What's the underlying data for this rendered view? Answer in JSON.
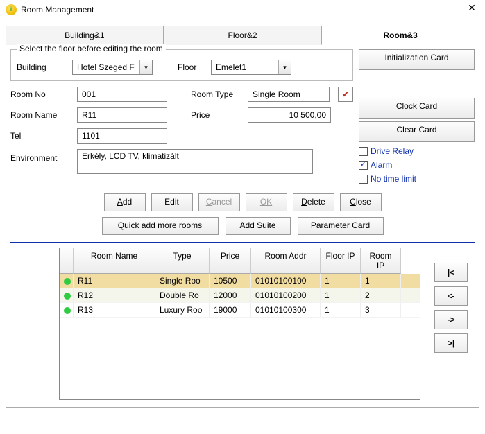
{
  "window": {
    "title": "Room Management"
  },
  "tabs": {
    "t1": "Building&1",
    "t2": "Floor&2",
    "t3": "Room&3"
  },
  "group": {
    "label": "Select the floor before editing the room"
  },
  "labels": {
    "building": "Building",
    "floor": "Floor",
    "roomno": "Room No",
    "roomtype": "Room Type",
    "roomname": "Room Name",
    "price": "Price",
    "tel": "Tel",
    "env": "Environment"
  },
  "values": {
    "building": "Hotel Szeged F",
    "floor": "Emelet1",
    "roomno": "001",
    "roomtype": "Single Room",
    "roomname": "R11",
    "price": "10 500,00",
    "tel": "1101",
    "env": "Erkély, LCD TV, klimatizált"
  },
  "buttons": {
    "init": "Initialization Card",
    "clock": "Clock Card",
    "clear": "Clear Card",
    "add": "Add",
    "edit": "Edit",
    "cancel": "Cancel",
    "ok": "OK",
    "delete": "Delete",
    "close": "Close",
    "quickadd": "Quick add more rooms",
    "addsuite": "Add Suite",
    "paramcard": "Parameter Card"
  },
  "checks": {
    "drive": "Drive Relay",
    "alarm": "Alarm",
    "nolimit": "No time limit",
    "alarm_checked": "☑"
  },
  "table": {
    "headers": {
      "name": "Room Name",
      "type": "Type",
      "price": "Price",
      "addr": "Room Addr",
      "floorip": "Floor IP",
      "roomip": "Room IP"
    },
    "rows": [
      {
        "name": "R11",
        "type": "Single Roo",
        "price": "10500",
        "addr": "01010100100",
        "floorip": "1",
        "roomip": "1"
      },
      {
        "name": "R12",
        "type": "Double Ro",
        "price": "12000",
        "addr": "01010100200",
        "floorip": "1",
        "roomip": "2"
      },
      {
        "name": "R13",
        "type": "Luxury Roo",
        "price": "19000",
        "addr": "01010100300",
        "floorip": "1",
        "roomip": "3"
      }
    ]
  },
  "nav": {
    "first": "|<",
    "prev": "<-",
    "next": "->",
    "last": ">|"
  }
}
